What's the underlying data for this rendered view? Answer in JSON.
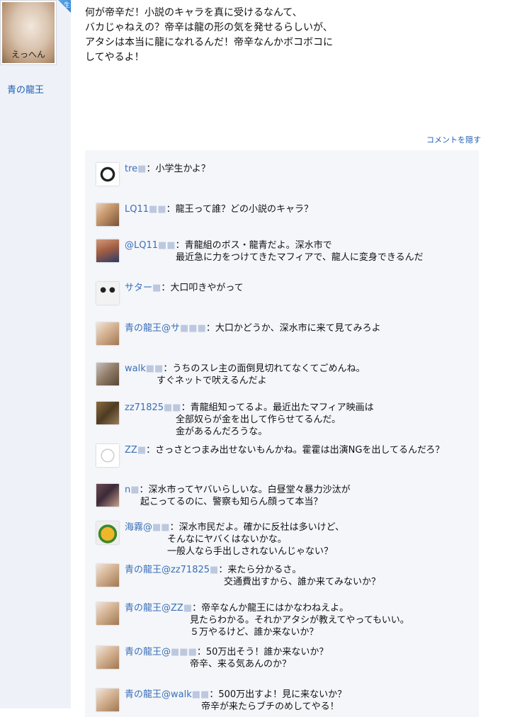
{
  "sidebar": {
    "avatar_caption": "えっへん",
    "corner_tag": "生",
    "poster_name": "青の龍王"
  },
  "post": {
    "lines": [
      "何が帝辛だ！小説のキャラを真に受けるなんて、",
      "バカじゃねえの？帝辛は龍の形の気を発せるらしいが、",
      "アタシは本当に龍になれるんだ！帝辛なんかボコボコに",
      "してやるよ！"
    ]
  },
  "hide_comments_label": "コメントを隠す",
  "comments": [
    {
      "avatar": "panda-avatar",
      "name": "tre",
      "mask": "■",
      "lines": [
        "：小学生かよ？"
      ]
    },
    {
      "avatar": "cat-avatar",
      "name": "LQ11",
      "mask": "■■",
      "lines": [
        "：龍王って誰？どの小説のキャラ？"
      ]
    },
    {
      "avatar": "man-avatar",
      "name": "@LQ11",
      "mask": "■■",
      "lines": [
        "：青龍組のボス・龍青だよ。深水市で",
        "最近急に力をつけてきたマフィアで、龍人に変身できるんだ"
      ]
    },
    {
      "avatar": "panda-avatar",
      "name": "サター",
      "mask": "■",
      "lines": [
        "：大口叩きやがって"
      ]
    },
    {
      "avatar": "dragon-avatar",
      "name": "青の龍王@サ",
      "mask": "■■■",
      "lines": [
        "：大口かどうか、深水市に来て見てみろよ"
      ]
    },
    {
      "avatar": "cat-avatar",
      "name": "walk",
      "mask": "■■",
      "lines": [
        "：うちのスレ主の面倒見切れてなくてごめんね。",
        "すぐネットで吠えるんだよ"
      ]
    },
    {
      "avatar": "dog-avatar",
      "name": "zz71825",
      "mask": "■■",
      "lines": [
        "：青龍組知ってるよ。最近出たマフィア映画は",
        "全部奴らが金を出して作らせてるんだ。",
        "金があるんだろうな。"
      ]
    },
    {
      "avatar": "swirl-avatar",
      "name": "ZZ",
      "mask": "■",
      "lines": [
        "：さっさとつまみ出せないもんかね。霍霍は出演NGを出してるんだろ？"
      ]
    },
    {
      "avatar": "girl-avatar",
      "name": "n",
      "mask": "■",
      "lines": [
        "：深水市ってヤバいらしいな。白昼堂々暴力沙汰が",
        "起こってるのに、警察も知らん顔って本当？"
      ]
    },
    {
      "avatar": "fruit-avatar",
      "name": "海霧@",
      "mask": "■■",
      "lines": [
        "：深水市民だよ。確かに反社は多いけど、",
        "そんなにヤバくはないかな。",
        "一般人なら手出しされないんじゃない？"
      ]
    },
    {
      "avatar": "dragon-avatar",
      "name": "青の龍王@zz71825",
      "mask": "■",
      "lines": [
        "：来たら分かるさ。",
        "交通費出すから、誰か来てみないか？"
      ]
    },
    {
      "avatar": "dragon-avatar",
      "name": "青の龍王@ZZ",
      "mask": "■",
      "lines": [
        "：帝辛なんか龍王にはかなわねえよ。",
        "見たらわかる。それかアタシが教えてやってもいい。",
        "５万やるけど、誰か来ないか？"
      ]
    },
    {
      "avatar": "dragon-avatar",
      "name": "青の龍王@",
      "mask": "■■■",
      "lines": [
        "：50万出そう！誰か来ないか？",
        "帝辛、来る気あんのか？"
      ]
    },
    {
      "avatar": "dragon-avatar",
      "name": "青の龍王@walk",
      "mask": "■■",
      "lines": [
        "：500万出すよ！見に来ないか？",
        "帝辛が来たらブチのめしてやる！"
      ]
    }
  ]
}
